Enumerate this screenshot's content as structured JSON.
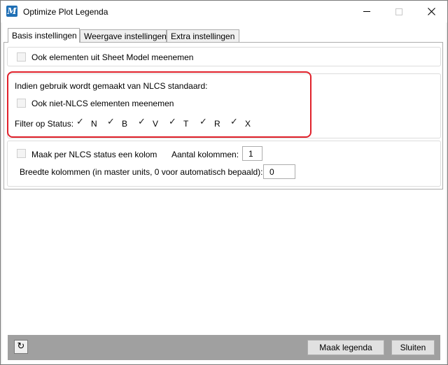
{
  "window": {
    "title": "Optimize Plot Legenda",
    "app_icon_glyph": "M",
    "controls": {
      "minimize": "minimize",
      "maximize": "maximize",
      "close": "✕"
    }
  },
  "tabs": [
    {
      "label": "Basis instellingen",
      "active": true
    },
    {
      "label": "Weergave instellingen",
      "active": false
    },
    {
      "label": "Extra instellingen",
      "active": false
    }
  ],
  "basis": {
    "sheet_model": {
      "label": "Ook elementen uit Sheet Model meenemen",
      "checked": false
    },
    "nlcs": {
      "heading": "Indien gebruik wordt gemaakt van NLCS standaard:",
      "niet_nlcs": {
        "label": "Ook niet-NLCS elementen meenemen",
        "checked": false
      },
      "filter_label": "Filter op Status:",
      "statuses": [
        {
          "label": "N",
          "checked": true
        },
        {
          "label": "B",
          "checked": true
        },
        {
          "label": "V",
          "checked": true
        },
        {
          "label": "T",
          "checked": true
        },
        {
          "label": "R",
          "checked": true
        },
        {
          "label": "X",
          "checked": true
        }
      ]
    },
    "kolom": {
      "per_status": {
        "label": "Maak per NLCS status een kolom",
        "checked": false
      },
      "aantal_label": "Aantal kolommen:",
      "aantal_value": "1",
      "breedte_label": "Breedte kolommen (in master units, 0 voor automatisch bepaald):",
      "breedte_value": "0"
    }
  },
  "footer": {
    "refresh_icon": "↻",
    "maak_label": "Maak legenda",
    "sluiten_label": "Sluiten"
  },
  "colors": {
    "highlight": "#e0212b",
    "footer_bg": "#a0a0a0",
    "icon_blue": "#1f6fb5"
  }
}
